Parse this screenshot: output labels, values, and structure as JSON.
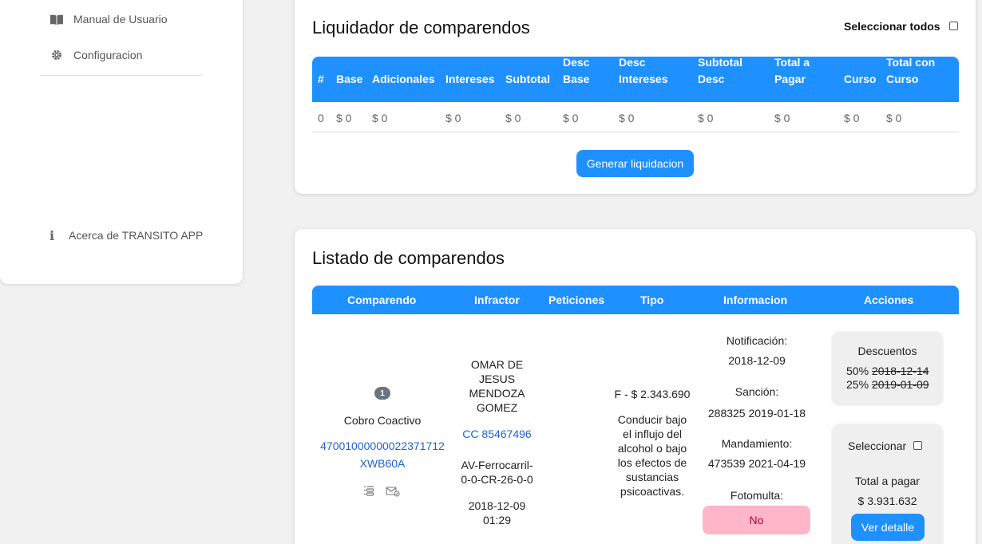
{
  "sidebar": {
    "items": [
      {
        "label": "Manual de Usuario",
        "icon": "book-icon"
      },
      {
        "label": "Configuracion",
        "icon": "gear-icon"
      }
    ],
    "about": {
      "label": "Acerca de TRANSITO APP",
      "icon": "info-icon"
    }
  },
  "liquidador": {
    "title": "Liquidador de comparendos",
    "select_all_label": "Seleccionar todos",
    "headers": [
      "#",
      "Base",
      "Adicionales",
      "Intereses",
      "Subtotal",
      "Desc Base",
      "Desc Intereses",
      "Subtotal Desc",
      "Total a Pagar",
      "Curso",
      "Total con Curso"
    ],
    "row": [
      "0",
      "$ 0",
      "$ 0",
      "$ 0",
      "$ 0",
      "$ 0",
      "$ 0",
      "$ 0",
      "$ 0",
      "$ 0",
      "$ 0"
    ],
    "generate_label": "Generar liquidacion"
  },
  "listado": {
    "title": "Listado de comparendos",
    "headers": {
      "comparendo": "Comparendo",
      "infractor": "Infractor",
      "peticiones": "Peticiones",
      "tipo": "Tipo",
      "informacion": "Informacion",
      "acciones": "Acciones"
    },
    "row": {
      "badge": "1",
      "estado": "Cobro Coactivo",
      "numero": "47001000000022371712",
      "placa": "XWB60A",
      "infractor_nombre_1": "OMAR DE",
      "infractor_nombre_2": "JESUS",
      "infractor_nombre_3": "MENDOZA",
      "infractor_nombre_4": "GOMEZ",
      "documento": "CC 85467496",
      "direccion_1": "AV-Ferrocarril-",
      "direccion_2": "0-0-CR-26-0-0",
      "fecha": "2018-12-09",
      "hora": "01:29",
      "tipo_valor": "F - $ 2.343.690",
      "tipo_desc": [
        "Conducir bajo",
        "el influjo del",
        "alcohol o bajo",
        "los efectos de",
        "sustancias",
        "psicoactivas."
      ],
      "notificacion_label": "Notificación:",
      "notificacion_fecha": "2018-12-09",
      "sancion_label": "Sanción:",
      "sancion_valor": "288325 2019-01-18",
      "mandamiento_label": "Mandamiento:",
      "mandamiento_valor": "473539 2021-04-19",
      "fotomulta_label": "Fotomulta:",
      "fotomulta_valor": "No",
      "descuentos_title": "Descuentos",
      "desc_50_pct": "50%",
      "desc_50_fecha": "2018-12-14",
      "desc_25_pct": "25%",
      "desc_25_fecha": "2019-01-09",
      "seleccionar_label": "Seleccionar",
      "total_label": "Total a pagar",
      "total_valor": "$ 3.931.632",
      "ver_detalle_label": "Ver detalle"
    }
  }
}
